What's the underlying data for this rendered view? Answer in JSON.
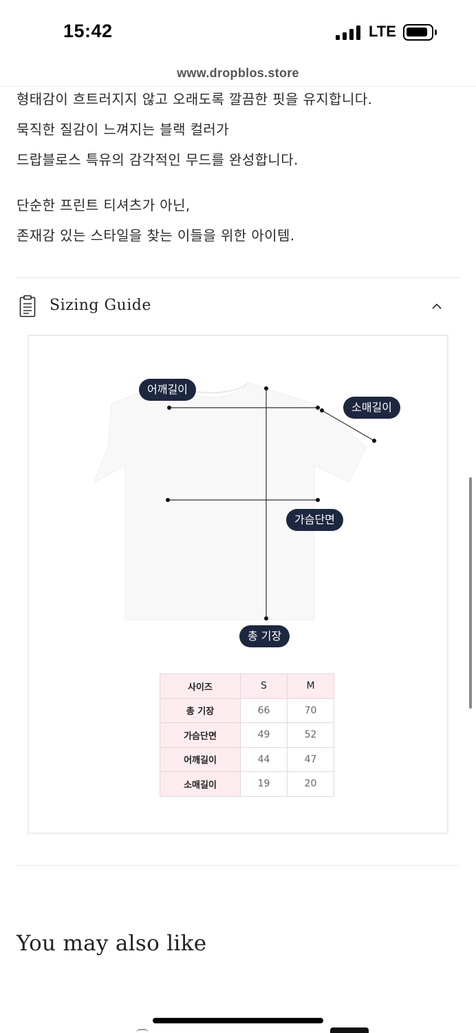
{
  "status_bar": {
    "time": "15:42",
    "network": "LTE",
    "signal_bars": 4,
    "battery_icon": "battery-icon"
  },
  "browser": {
    "url": "www.dropblos.store"
  },
  "description": {
    "paragraph1": [
      "형태감이 흐트러지지 않고 오래도록 깔끔한 핏을 유지합니다.",
      "묵직한 질감이 느껴지는 블랙 컬러가",
      "드랍블로스 특유의 감각적인 무드를 완성합니다."
    ],
    "paragraph2": [
      "단순한 프린트 티셔츠가 아닌,",
      "존재감 있는 스타일을 찾는 이들을 위한 아이템."
    ]
  },
  "sizing_guide": {
    "title": "Sizing Guide",
    "icon": "clipboard-icon",
    "toggle_icon": "chevron-up-icon",
    "measure_labels": {
      "shoulder": "어깨길이",
      "sleeve": "소매길이",
      "chest": "가슴단면",
      "length": "총 기장"
    },
    "table": {
      "header": [
        "사이즈",
        "S",
        "M"
      ],
      "rows": [
        [
          "총 기장",
          "66",
          "70"
        ],
        [
          "가슴단면",
          "49",
          "52"
        ],
        [
          "어깨길이",
          "44",
          "47"
        ],
        [
          "소매길이",
          "19",
          "20"
        ]
      ]
    }
  },
  "recommendations": {
    "title": "You may also like"
  },
  "colors": {
    "pill_bg": "#1e2740",
    "table_header_bg": "#fcecef"
  }
}
